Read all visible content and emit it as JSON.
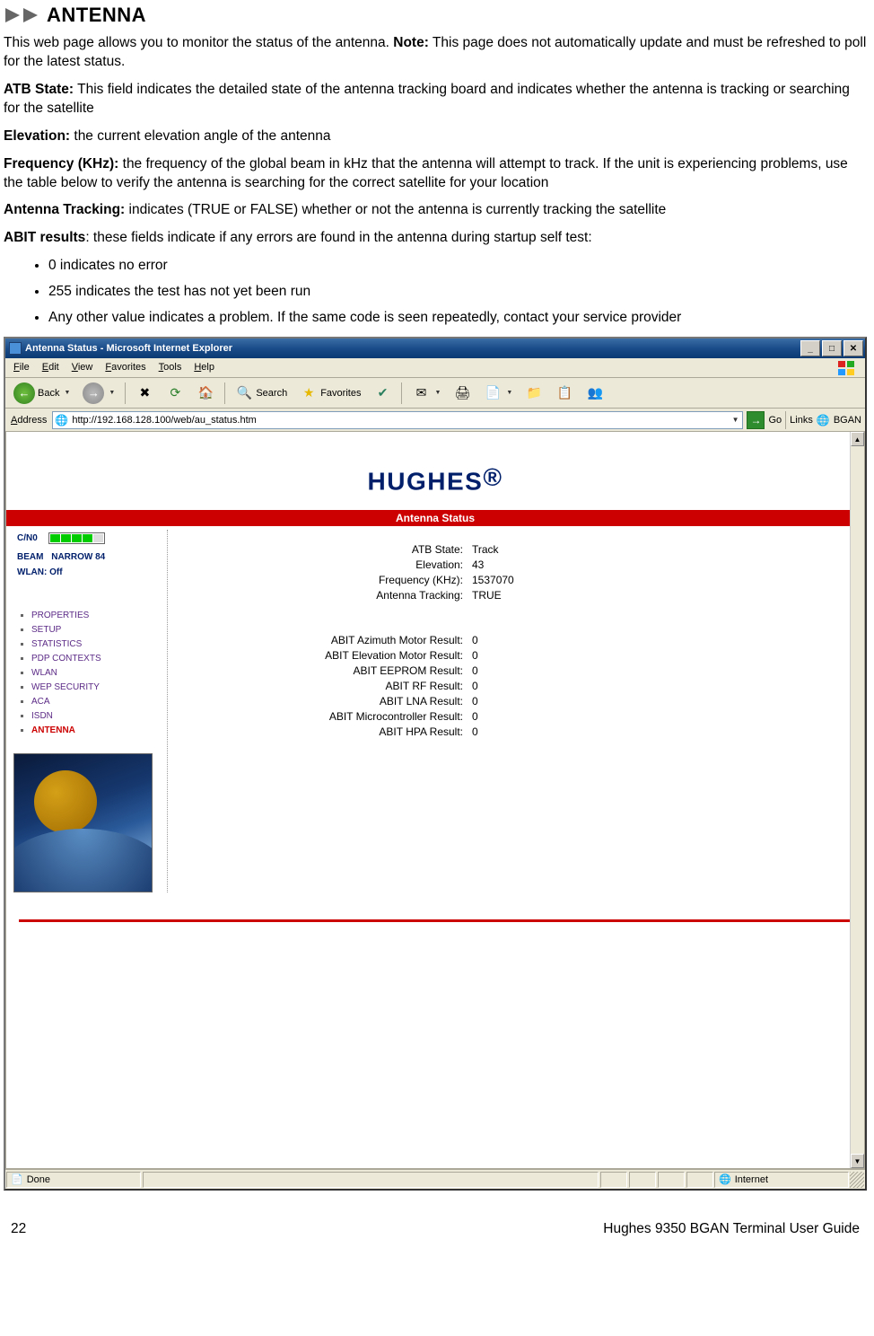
{
  "doc": {
    "section_title": "ANTENNA",
    "intro_pre": "This web page allows you to monitor the status of the antenna. ",
    "intro_bold": "Note:",
    "intro_post": " This page does not automatically update and must be refreshed to poll for the latest status.",
    "atb_label": "ATB State:",
    "atb_text": " This field indicates the detailed state of the antenna tracking board and indicates whether the antenna is tracking or searching for the satellite",
    "elev_label": "Elevation:",
    "elev_text": " the current elevation angle of the antenna",
    "freq_label": "Frequency (KHz):",
    "freq_text": " the frequency of the global beam in kHz that the antenna will attempt to track. If the unit is experiencing problems, use the table below to verify the antenna is searching for the correct satellite for your location",
    "track_label": "Antenna Tracking:",
    "track_text": " indicates (TRUE or FALSE) whether or not the antenna is currently tracking the satellite",
    "abit_label": "ABIT results",
    "abit_text": ": these fields indicate if any errors are found in the antenna during startup self test:",
    "bullets": [
      "0 indicates no error",
      "255 indicates the test has not yet been run",
      "Any other value indicates a problem. If the same code is seen repeatedly, contact your service provider"
    ],
    "page_number": "22",
    "footer_text": "Hughes 9350 BGAN Terminal User Guide"
  },
  "ie": {
    "title": "Antenna Status - Microsoft Internet Explorer",
    "menu": [
      "File",
      "Edit",
      "View",
      "Favorites",
      "Tools",
      "Help"
    ],
    "toolbar": {
      "back": "Back",
      "search": "Search",
      "favorites": "Favorites"
    },
    "address_label": "Address",
    "url": "http://192.168.128.100/web/au_status.htm",
    "go": "Go",
    "links_label": "Links",
    "bgan_link": "BGAN",
    "status_done": "Done",
    "status_zone": "Internet"
  },
  "page": {
    "logo_text": "HUGHES",
    "banner": "Antenna Status",
    "left": {
      "cno_label": "C/N0",
      "beam_label": "BEAM",
      "beam_value": "NARROW 84",
      "wlan": "WLAN: Off",
      "nav": [
        "PROPERTIES",
        "SETUP",
        "STATISTICS",
        "PDP CONTEXTS",
        "WLAN",
        "WEP SECURITY",
        "ACA",
        "ISDN",
        "ANTENNA"
      ]
    },
    "status": {
      "rows": [
        {
          "k": "ATB State:",
          "v": "Track"
        },
        {
          "k": "Elevation:",
          "v": "43"
        },
        {
          "k": "Frequency (KHz):",
          "v": "1537070"
        },
        {
          "k": "Antenna Tracking:",
          "v": "TRUE"
        }
      ],
      "abit": [
        {
          "k": "ABIT Azimuth Motor Result:",
          "v": "0"
        },
        {
          "k": "ABIT Elevation Motor Result:",
          "v": "0"
        },
        {
          "k": "ABIT EEPROM Result:",
          "v": "0"
        },
        {
          "k": "ABIT RF Result:",
          "v": "0"
        },
        {
          "k": "ABIT LNA Result:",
          "v": "0"
        },
        {
          "k": "ABIT Microcontroller Result:",
          "v": "0"
        },
        {
          "k": "ABIT HPA Result:",
          "v": "0"
        }
      ]
    }
  }
}
